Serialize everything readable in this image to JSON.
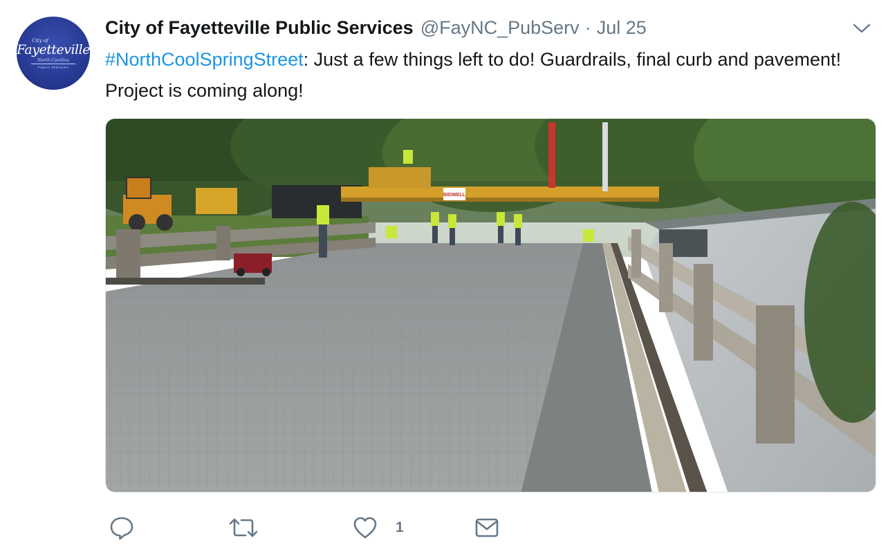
{
  "author": {
    "avatar": {
      "small_text": "City of",
      "main_text": "Fayetteville",
      "sub_text": "North Carolina",
      "dept_text": "PUBLIC SERVICES",
      "bg_color": "#273a93"
    },
    "display_name": "City of Fayetteville Public Services",
    "handle": "@FayNC_PubServ",
    "separator": "·",
    "timestamp": "Jul 25"
  },
  "tweet": {
    "hashtag": "#NorthCoolSpringStreet",
    "body": ": Just a few things left to do! Guardrails, final curb and pavement! Project is coming along!"
  },
  "media": {
    "sign_text": "BIDWELL"
  },
  "actions": {
    "reply_icon": "reply-icon",
    "retweet_icon": "retweet-icon",
    "like_icon": "like-icon",
    "like_count": "1",
    "dm_icon": "direct-message-icon"
  },
  "colors": {
    "link": "#1b95e0",
    "secondary_text": "#657786",
    "primary_text": "#14171a"
  }
}
